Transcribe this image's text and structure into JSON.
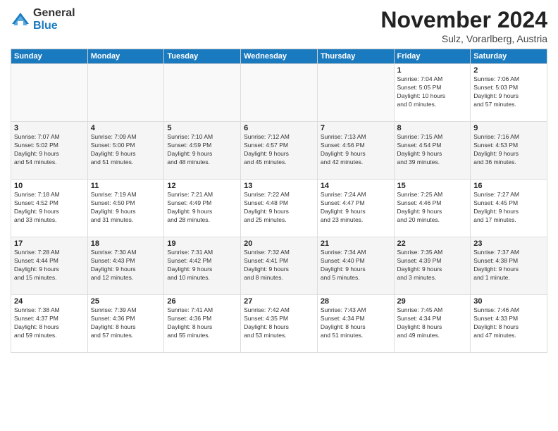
{
  "logo": {
    "general": "General",
    "blue": "Blue"
  },
  "title": {
    "month": "November 2024",
    "location": "Sulz, Vorarlberg, Austria"
  },
  "headers": [
    "Sunday",
    "Monday",
    "Tuesday",
    "Wednesday",
    "Thursday",
    "Friday",
    "Saturday"
  ],
  "weeks": [
    [
      {
        "day": "",
        "info": ""
      },
      {
        "day": "",
        "info": ""
      },
      {
        "day": "",
        "info": ""
      },
      {
        "day": "",
        "info": ""
      },
      {
        "day": "",
        "info": ""
      },
      {
        "day": "1",
        "info": "Sunrise: 7:04 AM\nSunset: 5:05 PM\nDaylight: 10 hours\nand 0 minutes."
      },
      {
        "day": "2",
        "info": "Sunrise: 7:06 AM\nSunset: 5:03 PM\nDaylight: 9 hours\nand 57 minutes."
      }
    ],
    [
      {
        "day": "3",
        "info": "Sunrise: 7:07 AM\nSunset: 5:02 PM\nDaylight: 9 hours\nand 54 minutes."
      },
      {
        "day": "4",
        "info": "Sunrise: 7:09 AM\nSunset: 5:00 PM\nDaylight: 9 hours\nand 51 minutes."
      },
      {
        "day": "5",
        "info": "Sunrise: 7:10 AM\nSunset: 4:59 PM\nDaylight: 9 hours\nand 48 minutes."
      },
      {
        "day": "6",
        "info": "Sunrise: 7:12 AM\nSunset: 4:57 PM\nDaylight: 9 hours\nand 45 minutes."
      },
      {
        "day": "7",
        "info": "Sunrise: 7:13 AM\nSunset: 4:56 PM\nDaylight: 9 hours\nand 42 minutes."
      },
      {
        "day": "8",
        "info": "Sunrise: 7:15 AM\nSunset: 4:54 PM\nDaylight: 9 hours\nand 39 minutes."
      },
      {
        "day": "9",
        "info": "Sunrise: 7:16 AM\nSunset: 4:53 PM\nDaylight: 9 hours\nand 36 minutes."
      }
    ],
    [
      {
        "day": "10",
        "info": "Sunrise: 7:18 AM\nSunset: 4:52 PM\nDaylight: 9 hours\nand 33 minutes."
      },
      {
        "day": "11",
        "info": "Sunrise: 7:19 AM\nSunset: 4:50 PM\nDaylight: 9 hours\nand 31 minutes."
      },
      {
        "day": "12",
        "info": "Sunrise: 7:21 AM\nSunset: 4:49 PM\nDaylight: 9 hours\nand 28 minutes."
      },
      {
        "day": "13",
        "info": "Sunrise: 7:22 AM\nSunset: 4:48 PM\nDaylight: 9 hours\nand 25 minutes."
      },
      {
        "day": "14",
        "info": "Sunrise: 7:24 AM\nSunset: 4:47 PM\nDaylight: 9 hours\nand 23 minutes."
      },
      {
        "day": "15",
        "info": "Sunrise: 7:25 AM\nSunset: 4:46 PM\nDaylight: 9 hours\nand 20 minutes."
      },
      {
        "day": "16",
        "info": "Sunrise: 7:27 AM\nSunset: 4:45 PM\nDaylight: 9 hours\nand 17 minutes."
      }
    ],
    [
      {
        "day": "17",
        "info": "Sunrise: 7:28 AM\nSunset: 4:44 PM\nDaylight: 9 hours\nand 15 minutes."
      },
      {
        "day": "18",
        "info": "Sunrise: 7:30 AM\nSunset: 4:43 PM\nDaylight: 9 hours\nand 12 minutes."
      },
      {
        "day": "19",
        "info": "Sunrise: 7:31 AM\nSunset: 4:42 PM\nDaylight: 9 hours\nand 10 minutes."
      },
      {
        "day": "20",
        "info": "Sunrise: 7:32 AM\nSunset: 4:41 PM\nDaylight: 9 hours\nand 8 minutes."
      },
      {
        "day": "21",
        "info": "Sunrise: 7:34 AM\nSunset: 4:40 PM\nDaylight: 9 hours\nand 5 minutes."
      },
      {
        "day": "22",
        "info": "Sunrise: 7:35 AM\nSunset: 4:39 PM\nDaylight: 9 hours\nand 3 minutes."
      },
      {
        "day": "23",
        "info": "Sunrise: 7:37 AM\nSunset: 4:38 PM\nDaylight: 9 hours\nand 1 minute."
      }
    ],
    [
      {
        "day": "24",
        "info": "Sunrise: 7:38 AM\nSunset: 4:37 PM\nDaylight: 8 hours\nand 59 minutes."
      },
      {
        "day": "25",
        "info": "Sunrise: 7:39 AM\nSunset: 4:36 PM\nDaylight: 8 hours\nand 57 minutes."
      },
      {
        "day": "26",
        "info": "Sunrise: 7:41 AM\nSunset: 4:36 PM\nDaylight: 8 hours\nand 55 minutes."
      },
      {
        "day": "27",
        "info": "Sunrise: 7:42 AM\nSunset: 4:35 PM\nDaylight: 8 hours\nand 53 minutes."
      },
      {
        "day": "28",
        "info": "Sunrise: 7:43 AM\nSunset: 4:34 PM\nDaylight: 8 hours\nand 51 minutes."
      },
      {
        "day": "29",
        "info": "Sunrise: 7:45 AM\nSunset: 4:34 PM\nDaylight: 8 hours\nand 49 minutes."
      },
      {
        "day": "30",
        "info": "Sunrise: 7:46 AM\nSunset: 4:33 PM\nDaylight: 8 hours\nand 47 minutes."
      }
    ]
  ]
}
